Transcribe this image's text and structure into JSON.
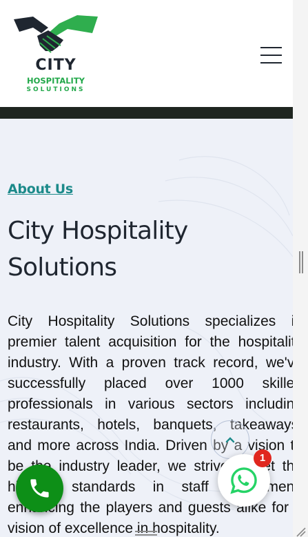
{
  "header": {
    "logo": {
      "line1": "CITY",
      "line2": "HOSPITALITY",
      "line3": "SOLUTIONS",
      "icon": "handshake-icon",
      "colors": {
        "dark": "#1f2630",
        "green": "#22a84a"
      }
    },
    "menu_icon": "hamburger-menu-icon"
  },
  "about": {
    "eyebrow": "About Us",
    "title": "City Hospitality Solutions",
    "body": "City Hospitality Solutions specializes in premier talent acquisition for the hospitality industry. With a proven track record, we've successfully placed over 1000 skilled professionals in various sectors including restaurants, hotels, banquets, takeaways, and more across India. Driven by a vision to be the industry leader, we strive to set the highest standards in staff recruitment, enhancing the players and guests alike for a vision of excellence in hospitality."
  },
  "floating": {
    "call_icon": "phone-icon",
    "whatsapp_icon": "whatsapp-icon",
    "whatsapp_badge": "1",
    "back_to_top_icon": "chevron-up-icon"
  },
  "colors": {
    "accent_teal": "#1c8a8a",
    "section_bg": "#eef1f8",
    "call_green": "#0d8f17",
    "whatsapp_green": "#25d366",
    "badge_red": "#e0271f"
  }
}
